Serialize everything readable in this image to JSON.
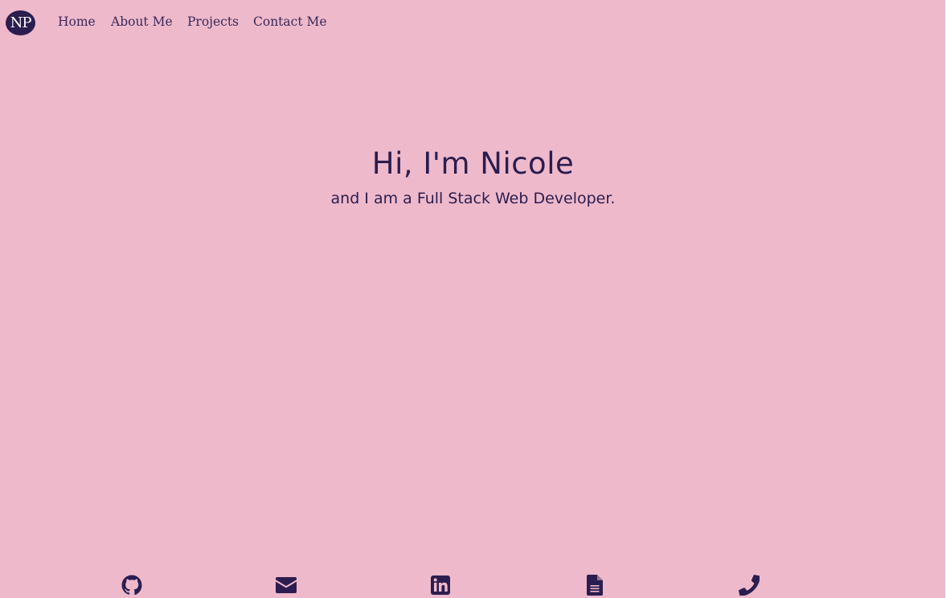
{
  "nav": {
    "logo": "NP",
    "links": [
      "Home",
      "About Me",
      "Projects",
      "Contact Me"
    ]
  },
  "hero": {
    "title": "Hi, I'm Nicole",
    "subtitle": "and I am a Full Stack Web Developer."
  },
  "social_icons": [
    "github-icon",
    "envelope-icon",
    "linkedin-icon",
    "resume-document-icon",
    "phone-icon"
  ],
  "colors": {
    "background": "#eeb9cb",
    "text": "#2b1d4f"
  }
}
